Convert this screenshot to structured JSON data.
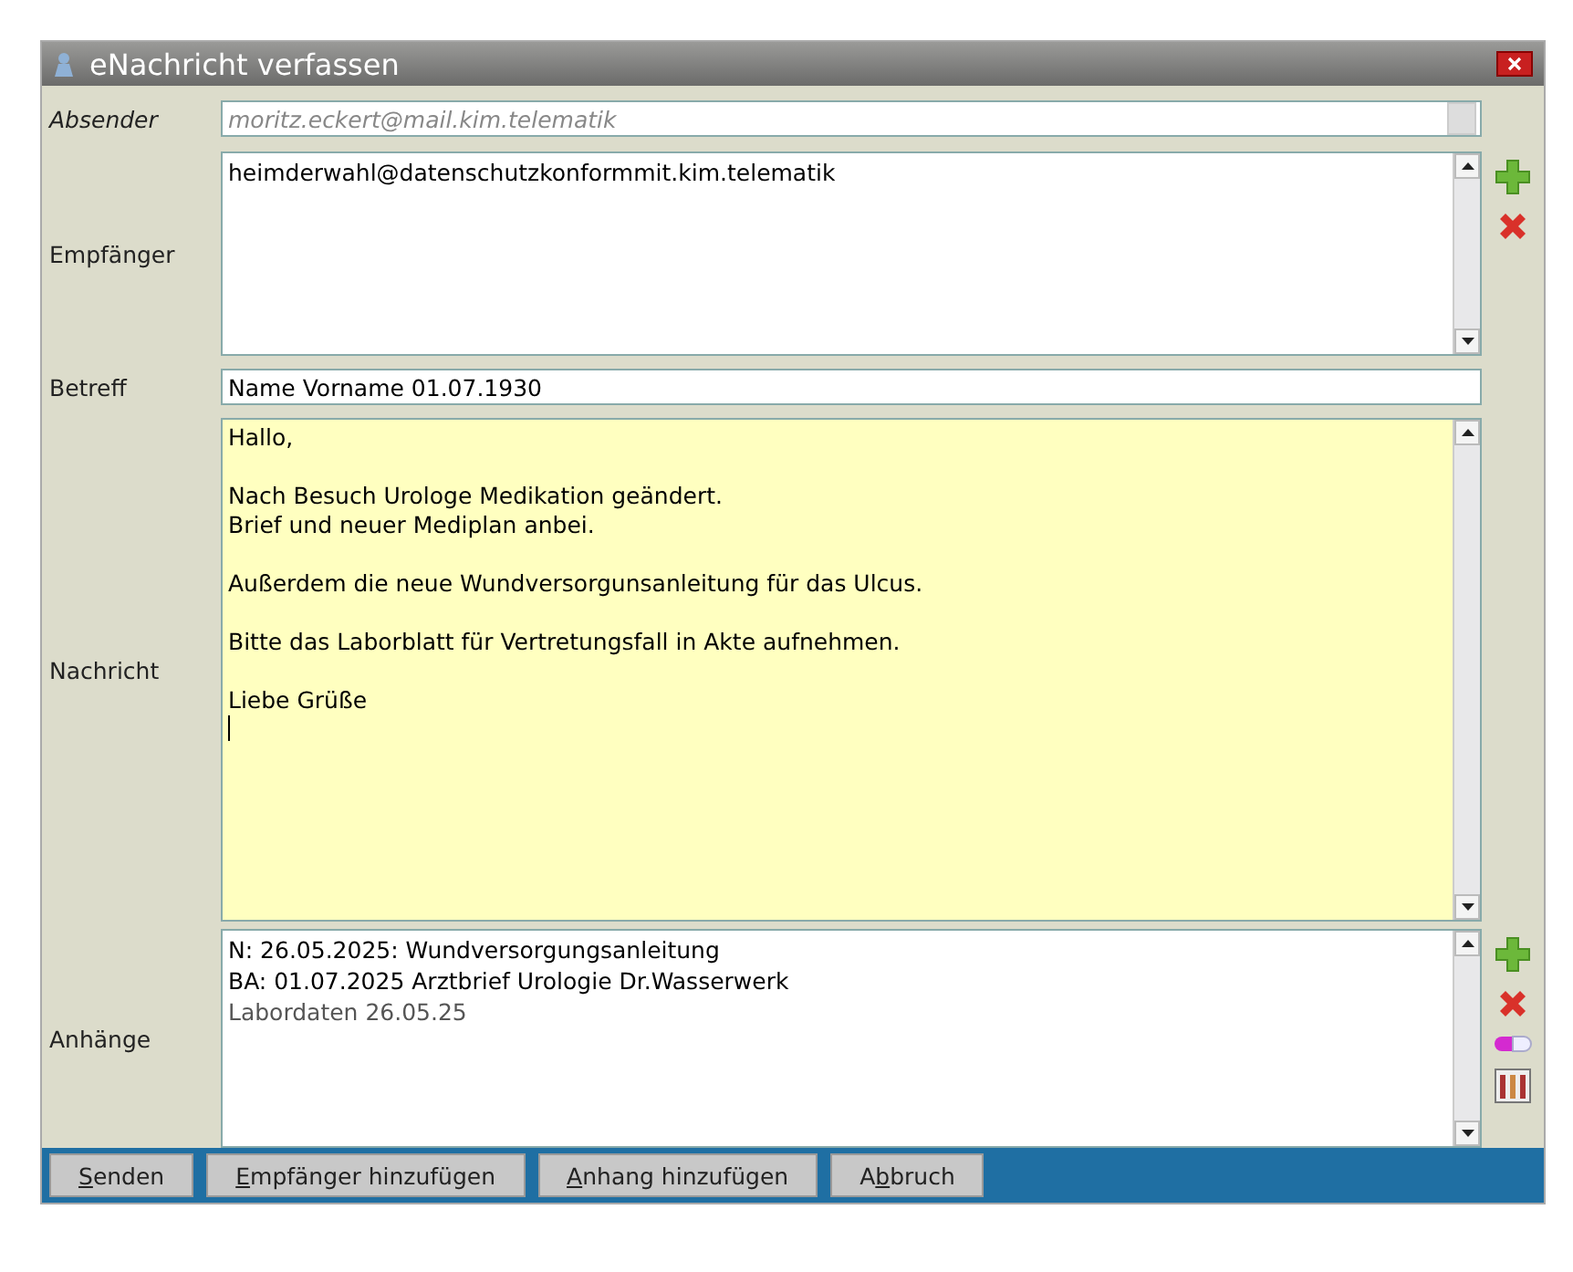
{
  "window": {
    "title": "eNachricht verfassen"
  },
  "sender": {
    "label": "Absender",
    "value": "moritz.eckert@mail.kim.telematik",
    "disabled": true
  },
  "recipients": {
    "label": "Empfänger",
    "items": [
      "heimderwahl@datenschutzkonformmit.kim.telematik"
    ]
  },
  "subject": {
    "label": "Betreff",
    "value": "Name Vorname 01.07.1930"
  },
  "message": {
    "label": "Nachricht",
    "paragraphs": [
      [
        "Hallo,"
      ],
      [
        "Nach Besuch Urologe Medikation geändert.",
        "Brief und neuer Mediplan anbei."
      ],
      [
        "Außerdem die neue Wundversorgunsanleitung für das Ulcus."
      ],
      [
        "Bitte das Laborblatt für Vertretungsfall in Akte aufnehmen."
      ],
      [
        "Liebe Grüße"
      ]
    ]
  },
  "attachments": {
    "label": "Anhänge",
    "items": [
      {
        "text": "N: 26.05.2025: Wundversorgungsanleitung",
        "dimmed": false
      },
      {
        "text": "BA: 01.07.2025 Arztbrief Urologie Dr.Wasserwerk",
        "dimmed": false
      },
      {
        "text": "Labordaten 26.05.25",
        "dimmed": true
      }
    ]
  },
  "buttons": [
    {
      "key": "S",
      "after": "enden"
    },
    {
      "key": "E",
      "after": "mpfänger hinzufügen"
    },
    {
      "key": "A",
      "after": "nhang hinzufügen"
    },
    {
      "before": "A",
      "key": "b",
      "after": "bruch"
    }
  ]
}
